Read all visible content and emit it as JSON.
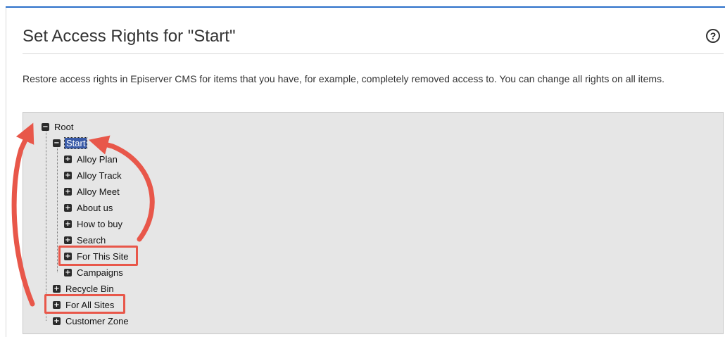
{
  "header": {
    "title": "Set Access Rights for \"Start\"",
    "help_icon_glyph": "?"
  },
  "description": "Restore access rights in Episerver CMS for items that you have, for example, completely removed access to. You can change all rights on all items.",
  "tree": {
    "root": {
      "label": "Root",
      "state": "expanded"
    },
    "start": {
      "label": "Start",
      "state": "expanded",
      "selected": true
    },
    "children": [
      {
        "label": "Alloy Plan"
      },
      {
        "label": "Alloy Track"
      },
      {
        "label": "Alloy Meet"
      },
      {
        "label": "About us"
      },
      {
        "label": "How to buy"
      },
      {
        "label": "Search"
      },
      {
        "label": "For This Site",
        "highlighted": true
      },
      {
        "label": "Campaigns"
      }
    ],
    "root_siblings": [
      {
        "label": "Recycle Bin"
      },
      {
        "label": "For All Sites",
        "highlighted": true
      },
      {
        "label": "Customer Zone"
      }
    ],
    "toggle_glyphs": {
      "expanded": "−",
      "collapsed": "+"
    }
  },
  "colors": {
    "accent_bar": "#2b6fc9",
    "selection": "#3a5ba8",
    "annotation": "#e8574a",
    "tree_background": "#e6e6e6"
  },
  "annotations": {
    "icon": "curved-arrow-icon",
    "boxes": [
      "For This Site",
      "For All Sites"
    ]
  }
}
